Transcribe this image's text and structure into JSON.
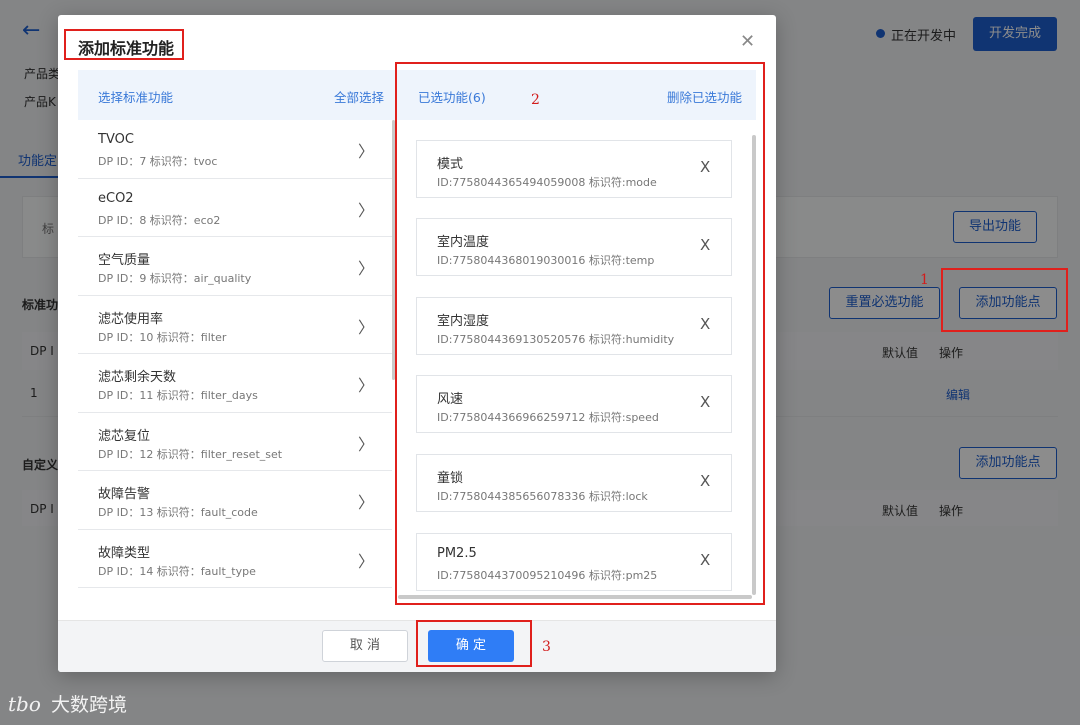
{
  "background": {
    "back_arrow": "←",
    "status_text": "正在开发中",
    "finish_button": "开发完成",
    "product_label_1": "产品类",
    "product_label_2": "产品K",
    "tab_label": "功能定",
    "filter_label": "标",
    "export_button": "导出功能",
    "standard_section": "标准功",
    "reset_required_button": "重置必选功能",
    "add_dp_button_1": "添加功能点",
    "table1_col_dp": "DP I",
    "table1_col_default": "默认值",
    "table1_col_action": "操作",
    "row1_id": "1",
    "row1_edit": "编辑",
    "custom_section": "自定义",
    "add_dp_button_2": "添加功能点",
    "table2_col_dp": "DP I",
    "table2_col_default": "默认值",
    "table2_col_action": "操作"
  },
  "modal": {
    "title": "添加标准功能",
    "close_icon": "close-icon",
    "left_panel": {
      "header": "选择标准功能",
      "select_all": "全部选择",
      "items": [
        {
          "name": "TVOC",
          "meta": "DP ID：7  标识符：tvoc"
        },
        {
          "name": "eCO2",
          "meta": "DP ID：8  标识符：eco2"
        },
        {
          "name": "空气质量",
          "meta": "DP ID：9  标识符：air_quality"
        },
        {
          "name": "滤芯使用率",
          "meta": "DP ID：10  标识符：filter"
        },
        {
          "name": "滤芯剩余天数",
          "meta": "DP ID：11  标识符：filter_days"
        },
        {
          "name": "滤芯复位",
          "meta": "DP ID：12  标识符：filter_reset_set"
        },
        {
          "name": "故障告警",
          "meta": "DP ID：13  标识符：fault_code"
        },
        {
          "name": "故障类型",
          "meta": "DP ID：14  标识符：fault_type"
        }
      ]
    },
    "right_panel": {
      "header": "已选功能(6)",
      "delete_selected": "删除已选功能",
      "items": [
        {
          "name": "模式",
          "meta": "ID:7758044365494059008   标识符:mode"
        },
        {
          "name": "室内温度",
          "meta": "ID:7758044368019030016   标识符:temp"
        },
        {
          "name": "室内湿度",
          "meta": "ID:7758044369130520576   标识符:humidity"
        },
        {
          "name": "风速",
          "meta": "ID:7758044366966259712   标识符:speed"
        },
        {
          "name": "童锁",
          "meta": "ID:7758044385656078336   标识符:lock"
        },
        {
          "name": "PM2.5",
          "meta": "ID:7758044370095210496   标识符:pm25"
        }
      ]
    },
    "cancel_button": "取 消",
    "ok_button": "确 定"
  },
  "annotations": {
    "n1": "1",
    "n2": "2",
    "n3": "3"
  },
  "watermark": {
    "logo": "tbo",
    "text": "大数跨境"
  },
  "colors": {
    "accent": "#2f7df6",
    "annotation": "#e0201c",
    "panel_header_bg": "#eef4fc"
  }
}
